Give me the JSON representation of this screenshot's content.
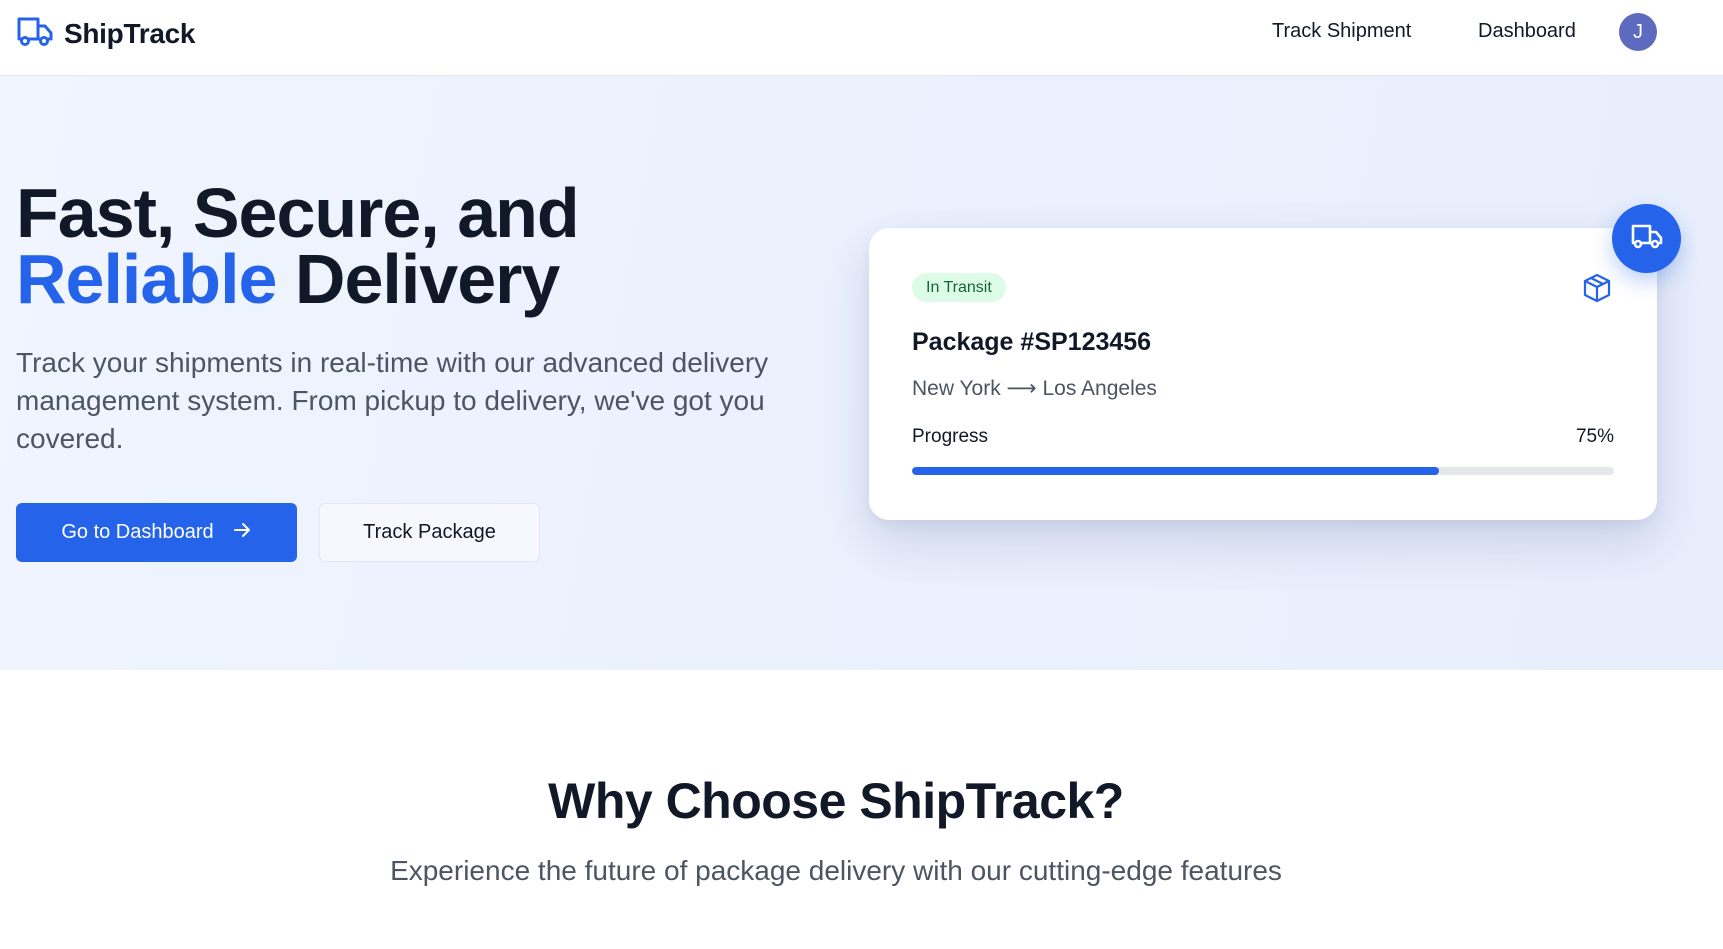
{
  "colors": {
    "accent": "#2563eb",
    "text_dark": "#111827",
    "text_muted": "#4b5563",
    "badge_bg": "#dcfce7",
    "badge_text": "#166534",
    "avatar_bg": "#5c6bc0"
  },
  "navbar": {
    "brand": "ShipTrack",
    "brand_icon": "truck-icon",
    "links": [
      "Track Shipment",
      "Dashboard"
    ],
    "avatar_initial": "J"
  },
  "hero": {
    "title_line1": "Fast, Secure, and",
    "title_accent": "Reliable",
    "title_rest": " Delivery",
    "description": "Track your shipments in real-time with our advanced delivery management system. From pickup to delivery, we've got you covered.",
    "primary_button": "Go to Dashboard",
    "primary_button_icon": "arrow-right-icon",
    "secondary_button": "Track Package"
  },
  "shipment_card": {
    "status": "In Transit",
    "status_icon": "package-icon",
    "package_title": "Package #SP123456",
    "route": "New York ⟶ Los Angeles",
    "progress_label": "Progress",
    "progress_text": "75%",
    "progress_percent": 75,
    "fab_icon": "truck-icon"
  },
  "features": {
    "title": "Why Choose ShipTrack?",
    "subtitle": "Experience the future of package delivery with our cutting-edge features"
  }
}
